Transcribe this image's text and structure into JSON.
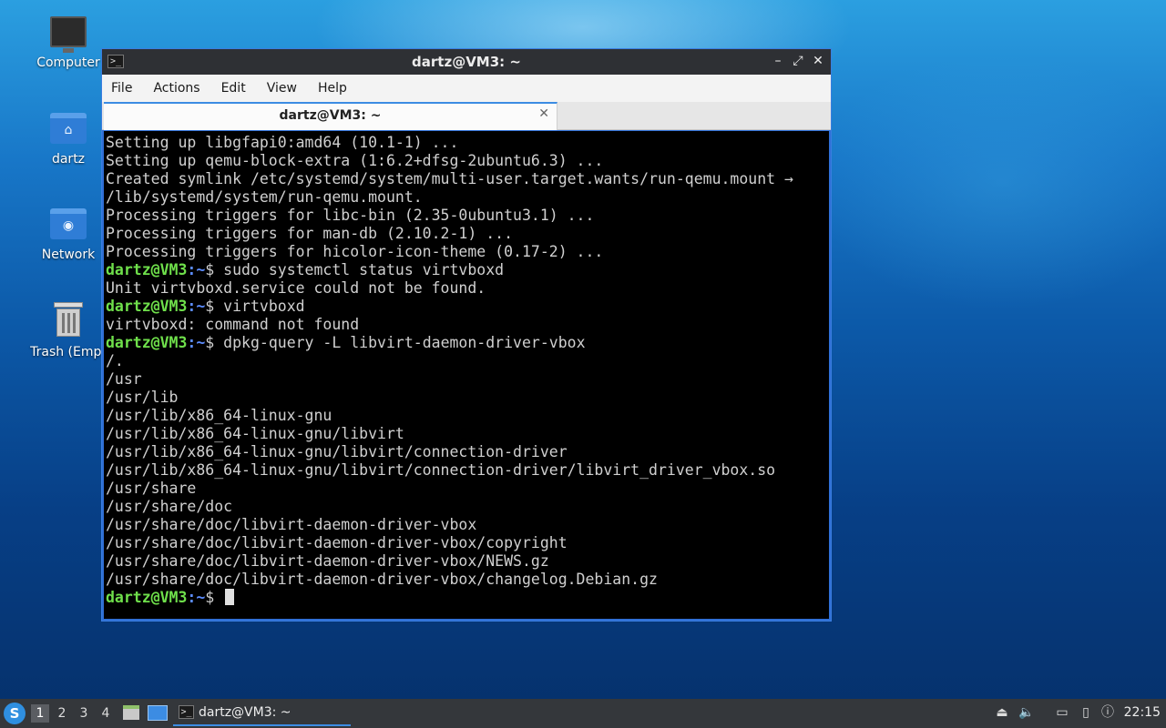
{
  "desktop": {
    "icons": [
      {
        "label": "Computer"
      },
      {
        "label": "dartz"
      },
      {
        "label": "Network"
      },
      {
        "label": "Trash (Empt"
      }
    ]
  },
  "window": {
    "title": "dartz@VM3: ~",
    "controls": {
      "minimize": "–",
      "maximize": "⤢",
      "close": "✕"
    },
    "menu": [
      "File",
      "Actions",
      "Edit",
      "View",
      "Help"
    ],
    "tab": {
      "label": "dartz@VM3: ~",
      "close": "✕"
    }
  },
  "terminal": {
    "prompt_user": "dartz@VM3",
    "prompt_path": ":~",
    "prompt_symbol": "$ ",
    "lines": [
      {
        "type": "out",
        "text": "Setting up libgfapi0:amd64 (10.1-1) ..."
      },
      {
        "type": "out",
        "text": "Setting up qemu-block-extra (1:6.2+dfsg-2ubuntu6.3) ..."
      },
      {
        "type": "out",
        "text": "Created symlink /etc/systemd/system/multi-user.target.wants/run-qemu.mount →"
      },
      {
        "type": "out",
        "text": "/lib/systemd/system/run-qemu.mount."
      },
      {
        "type": "out",
        "text": "Processing triggers for libc-bin (2.35-0ubuntu3.1) ..."
      },
      {
        "type": "out",
        "text": "Processing triggers for man-db (2.10.2-1) ..."
      },
      {
        "type": "out",
        "text": "Processing triggers for hicolor-icon-theme (0.17-2) ..."
      },
      {
        "type": "cmd",
        "text": "sudo systemctl status virtvboxd"
      },
      {
        "type": "out",
        "text": "Unit virtvboxd.service could not be found."
      },
      {
        "type": "cmd",
        "text": "virtvboxd"
      },
      {
        "type": "out",
        "text": "virtvboxd: command not found"
      },
      {
        "type": "cmd",
        "text": "dpkg-query -L libvirt-daemon-driver-vbox"
      },
      {
        "type": "out",
        "text": "/."
      },
      {
        "type": "out",
        "text": "/usr"
      },
      {
        "type": "out",
        "text": "/usr/lib"
      },
      {
        "type": "out",
        "text": "/usr/lib/x86_64-linux-gnu"
      },
      {
        "type": "out",
        "text": "/usr/lib/x86_64-linux-gnu/libvirt"
      },
      {
        "type": "out",
        "text": "/usr/lib/x86_64-linux-gnu/libvirt/connection-driver"
      },
      {
        "type": "out",
        "text": "/usr/lib/x86_64-linux-gnu/libvirt/connection-driver/libvirt_driver_vbox.so"
      },
      {
        "type": "out",
        "text": "/usr/share"
      },
      {
        "type": "out",
        "text": "/usr/share/doc"
      },
      {
        "type": "out",
        "text": "/usr/share/doc/libvirt-daemon-driver-vbox"
      },
      {
        "type": "out",
        "text": "/usr/share/doc/libvirt-daemon-driver-vbox/copyright"
      },
      {
        "type": "out",
        "text": "/usr/share/doc/libvirt-daemon-driver-vbox/NEWS.gz"
      },
      {
        "type": "out",
        "text": "/usr/share/doc/libvirt-daemon-driver-vbox/changelog.Debian.gz"
      },
      {
        "type": "cmd",
        "text": "",
        "cursor": true
      }
    ]
  },
  "taskbar": {
    "workspaces": [
      "1",
      "2",
      "3",
      "4"
    ],
    "active_workspace": "1",
    "task_label": "dartz@VM3: ~",
    "clock": "22:15"
  },
  "colors": {
    "prompt_user": "#6fe04b",
    "prompt_path": "#5c8dff",
    "accent": "#3c8ce3"
  }
}
